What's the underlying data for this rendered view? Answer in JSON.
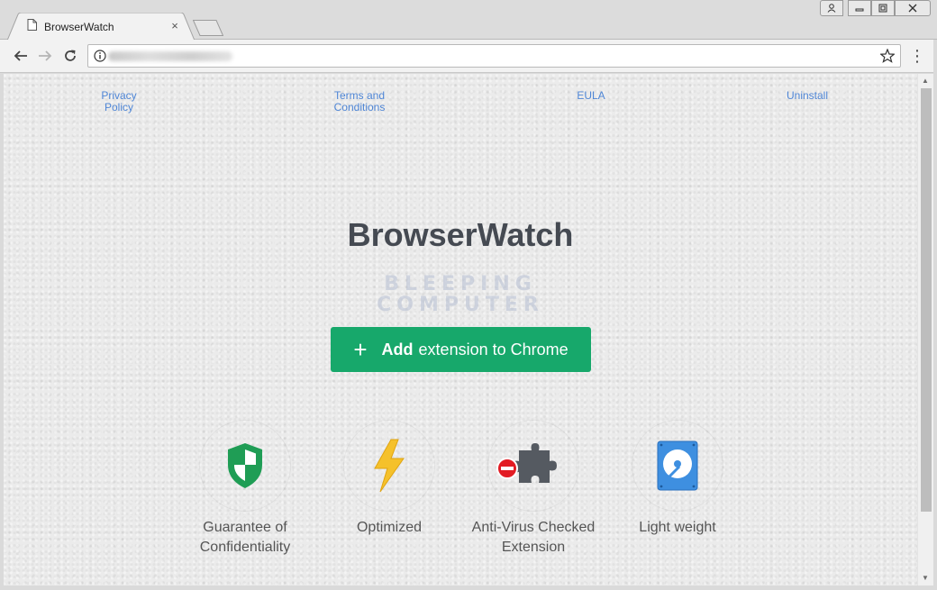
{
  "browser": {
    "tab_title": "BrowserWatch",
    "tab_close": "×",
    "menu_icon": "⋮"
  },
  "page": {
    "links": {
      "privacy": "Privacy Policy",
      "terms": "Terms and Conditions",
      "eula": "EULA",
      "uninstall": "Uninstall"
    },
    "title": "BrowserWatch",
    "watermark_line1": "BLEEPING",
    "watermark_line2": "COMPUTER",
    "add_button": {
      "plus": "+",
      "bold": "Add",
      "rest": "extension to Chrome"
    },
    "features": [
      {
        "icon": "shield-icon",
        "label": "Guarantee of Confidentiality"
      },
      {
        "icon": "lightning-icon",
        "label": "Optimized"
      },
      {
        "icon": "puzzle-icon",
        "label": "Anti-Virus Checked Extension"
      },
      {
        "icon": "hard-drive-icon",
        "label": "Light weight"
      }
    ]
  },
  "colors": {
    "accent_green": "#17a86b",
    "link_blue": "#4f86d6",
    "title_gray": "#454a52"
  }
}
